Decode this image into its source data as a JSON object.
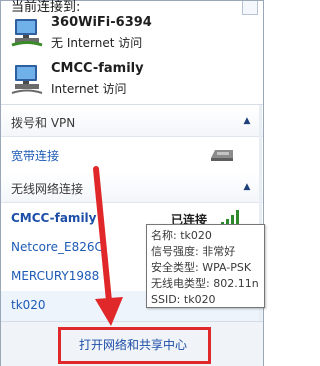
{
  "header": {
    "title": "当前连接到:"
  },
  "connections": [
    {
      "name": "360WiFi-6394",
      "status": "无 Internet 访问",
      "icon": "network-computer-icon"
    },
    {
      "name": "CMCC-family",
      "status": "Internet 访问",
      "icon": "network-computer-icon"
    }
  ],
  "sections": {
    "dialup": {
      "label": "拨号和 VPN",
      "items": [
        {
          "label": "宽带连接",
          "icon": "modem-icon"
        }
      ]
    },
    "wireless": {
      "label": "无线网络连接",
      "items": [
        {
          "label": "CMCC-family",
          "status": "已连接"
        },
        {
          "label": "Netcore_E826C"
        },
        {
          "label": "MERCURY1988"
        },
        {
          "label": "tk020"
        }
      ]
    }
  },
  "tooltip": {
    "lines": [
      "名称: tk020",
      "信号强度: 非常好",
      "安全类型: WPA-PSK",
      "无线电类型: 802.11n",
      "SSID: tk020"
    ]
  },
  "footer": {
    "link": "打开网络和共享中心"
  },
  "colors": {
    "link": "#1d5bb5",
    "highlight": "#e0282a",
    "arrow": "#e0282a"
  }
}
